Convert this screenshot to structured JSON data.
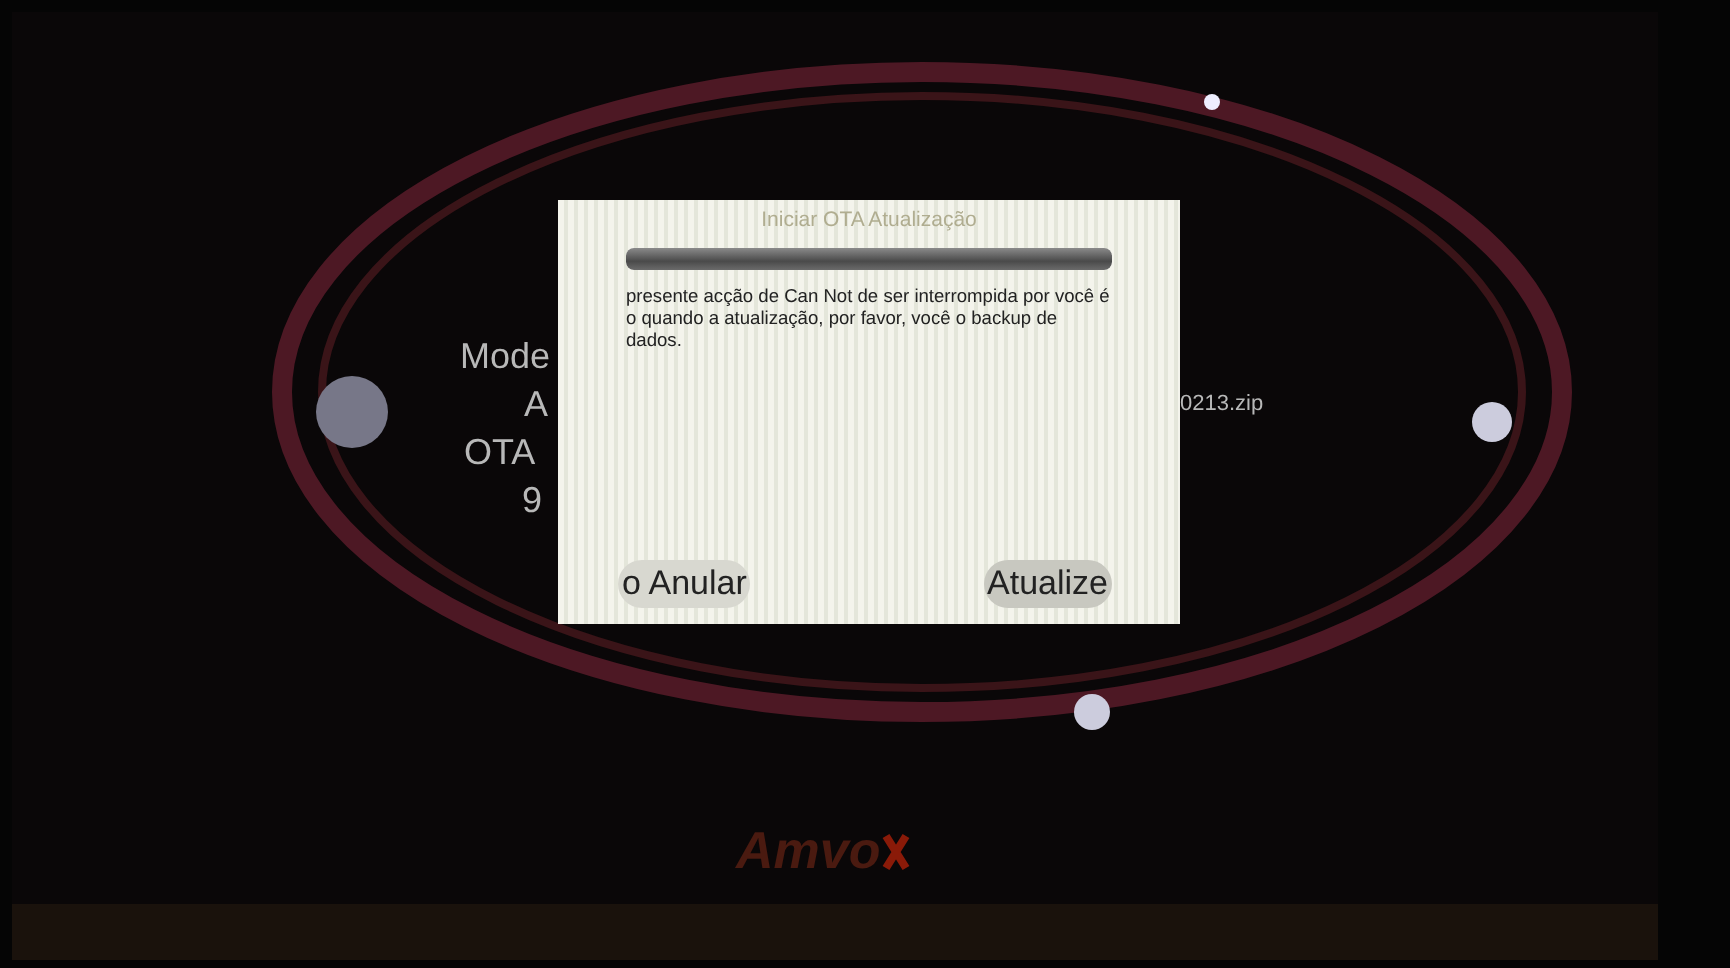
{
  "background": {
    "labels": [
      {
        "text": "Mode"
      },
      {
        "text": "A"
      },
      {
        "text": "OTA"
      },
      {
        "text": "9"
      },
      {
        "text": "0213.zip"
      }
    ],
    "logo": "Amvo"
  },
  "dialog": {
    "title": "Iniciar OTA Atualização",
    "progress": {
      "level": 1
    },
    "message": "presente acção de Can Not de ser interrompida por você é o quando a atualização, por favor, você o backup de dados.",
    "buttons": [
      {
        "label": "o Anular",
        "kind": "cancel"
      },
      {
        "label": "Atualize",
        "kind": "confirm"
      }
    ]
  }
}
